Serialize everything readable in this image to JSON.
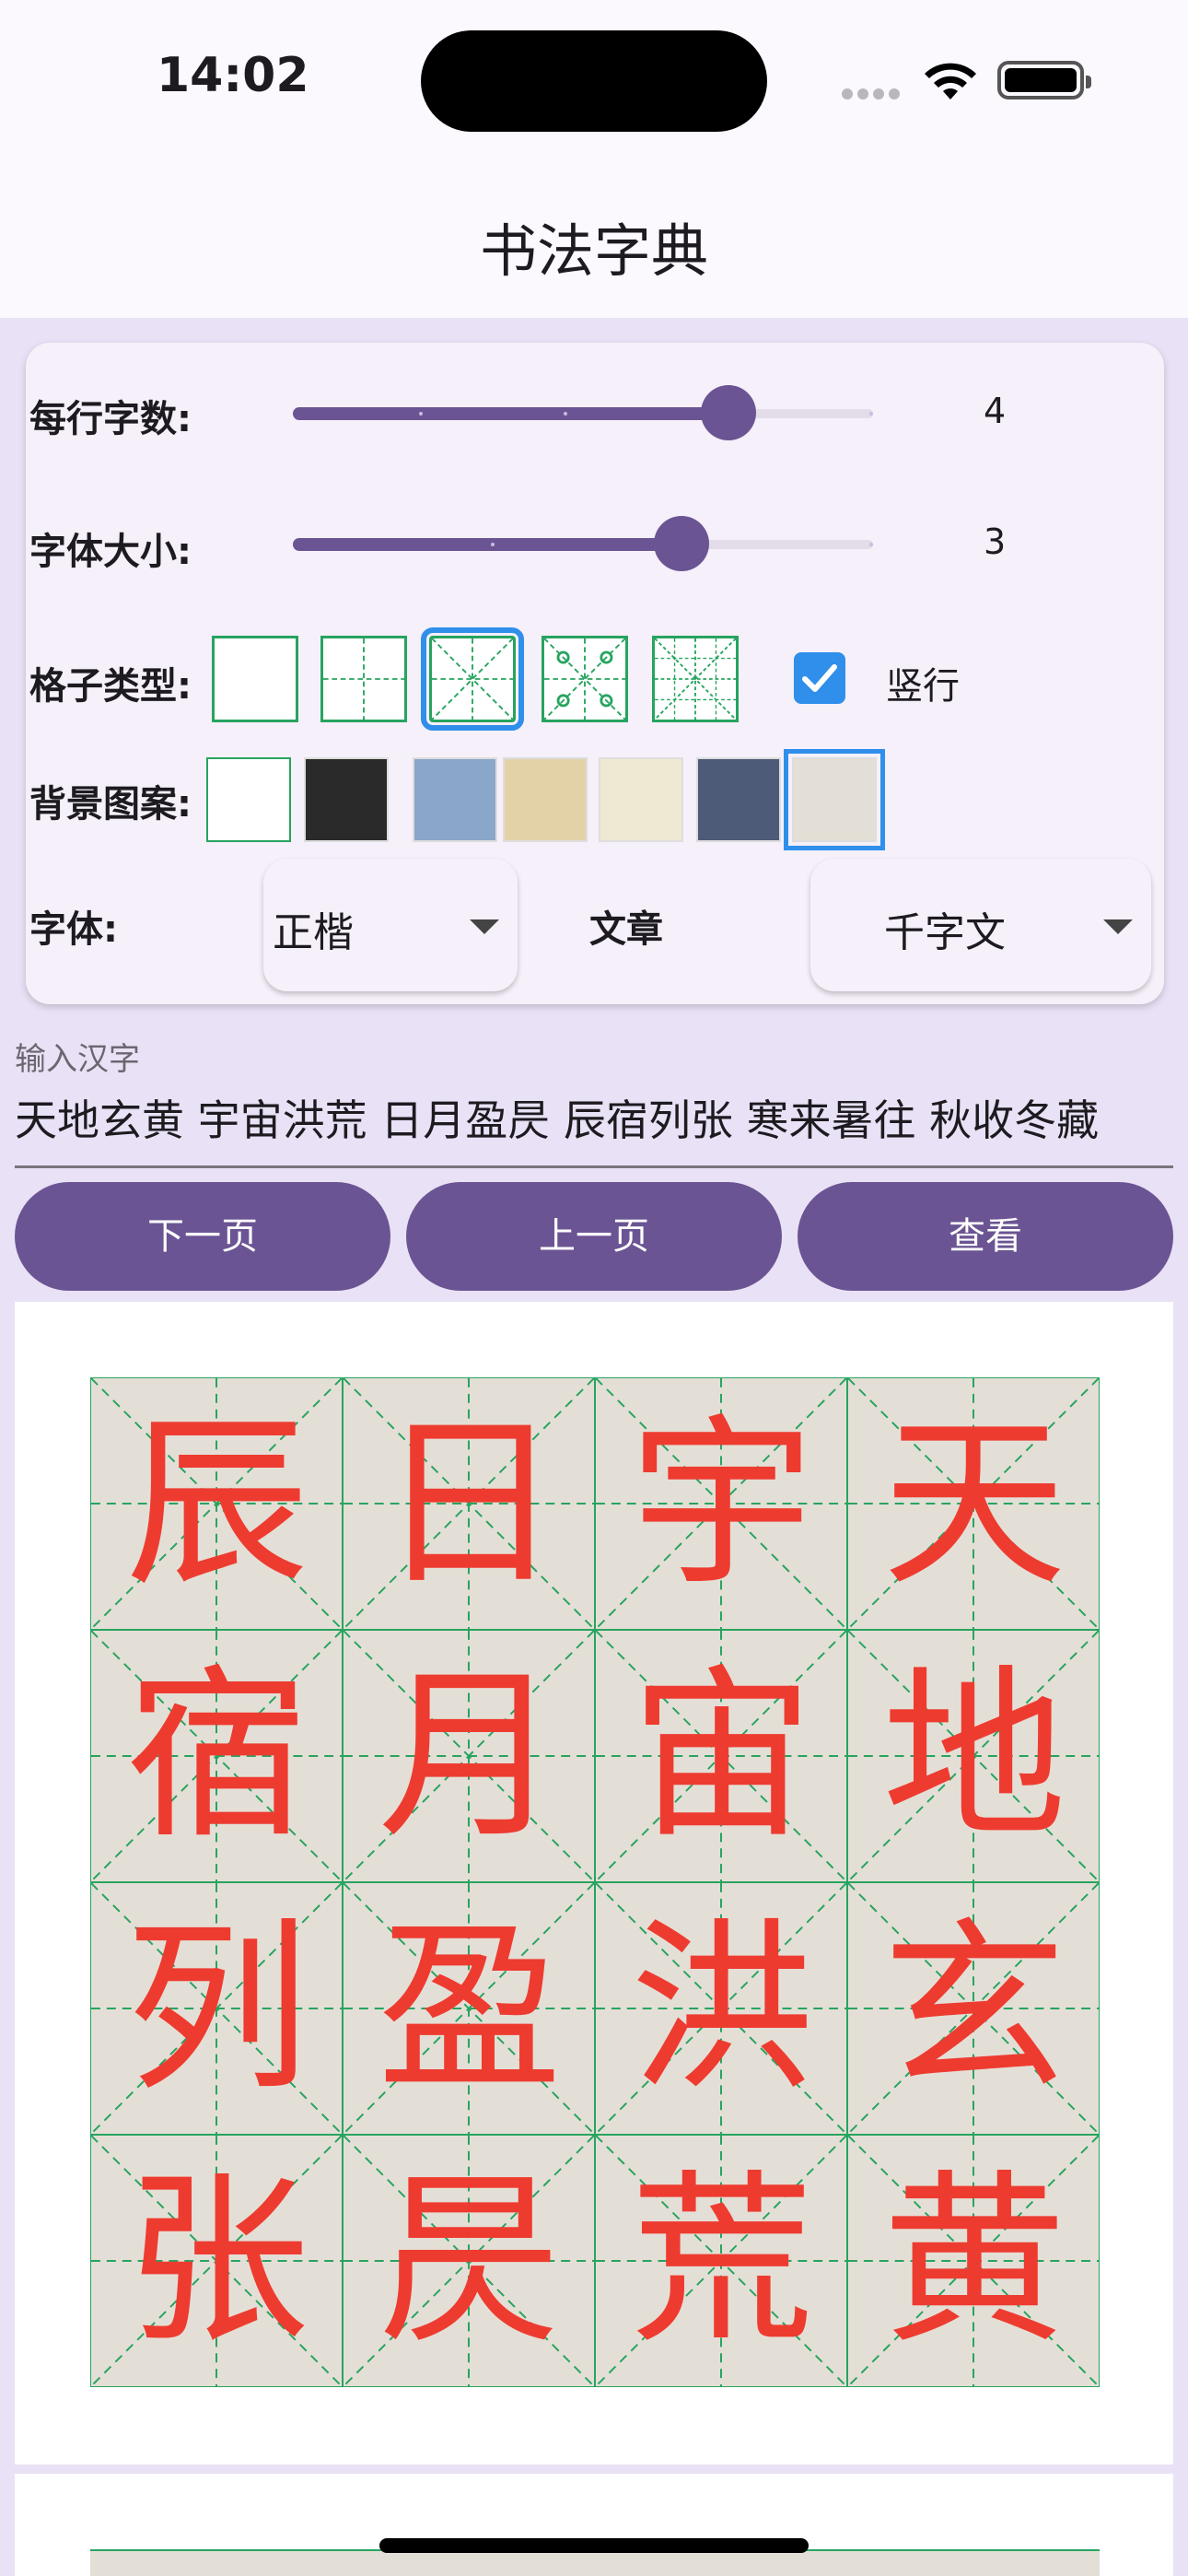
{
  "status": {
    "time": "14:02"
  },
  "app": {
    "title": "书法字典"
  },
  "settings": {
    "per_row": {
      "label": "每行字数:",
      "value": "4",
      "level": 0.75
    },
    "font_size": {
      "label": "字体大小:",
      "value": "3",
      "level": 0.67
    },
    "grid_type": {
      "label": "格子类型:",
      "options": [
        "plain-grid-icon",
        "tian-grid-icon",
        "mi-grid-icon",
        "circle-mi-grid-icon",
        "dense-mi-grid-icon"
      ],
      "selected_index": 2
    },
    "vertical": {
      "label": "竖行",
      "checked": true
    },
    "background": {
      "label": "背景图案:",
      "options": [
        "white",
        "black",
        "denim",
        "kraft",
        "cream",
        "slate",
        "rice-paper"
      ],
      "selected_index": 6
    },
    "font": {
      "label": "字体:",
      "value": "正楷"
    },
    "article": {
      "label": "文章",
      "value": "千字文"
    }
  },
  "input": {
    "label": "输入汉字",
    "value": "天地玄黄 宇宙洪荒 日月盈昃 辰宿列张 寒来暑往 秋收冬藏"
  },
  "buttons": {
    "next": "下一页",
    "prev": "上一页",
    "view": "查看"
  },
  "practice_grid": {
    "rows": [
      [
        "辰",
        "日",
        "宇",
        "天"
      ],
      [
        "宿",
        "月",
        "宙",
        "地"
      ],
      [
        "列",
        "盈",
        "洪",
        "玄"
      ],
      [
        "张",
        "昃",
        "荒",
        "黄"
      ]
    ],
    "char_color": "#ee3b30",
    "grid_color": "#27a45f"
  }
}
